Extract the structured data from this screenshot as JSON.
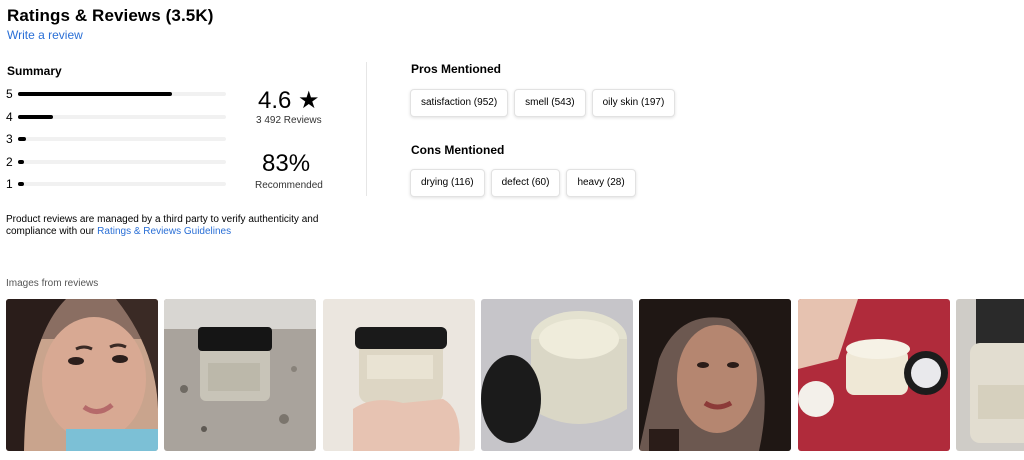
{
  "header": {
    "title": "Ratings & Reviews (3.5K)",
    "write_review": "Write a review"
  },
  "summary": {
    "label": "Summary",
    "distribution": [
      {
        "stars": "5",
        "fraction": 0.74
      },
      {
        "stars": "4",
        "fraction": 0.17
      },
      {
        "stars": "3",
        "fraction": 0.04
      },
      {
        "stars": "2",
        "fraction": 0.02
      },
      {
        "stars": "1",
        "fraction": 0.02
      }
    ],
    "average": "4.6 ★",
    "review_count": "3 492 Reviews",
    "recommended_pct": "83%",
    "recommended_label": "Recommended"
  },
  "pros": {
    "title": "Pros Mentioned",
    "items": [
      "satisfaction (952)",
      "smell (543)",
      "oily skin (197)"
    ]
  },
  "cons": {
    "title": "Cons Mentioned",
    "items": [
      "drying (116)",
      "defect (60)",
      "heavy (28)"
    ]
  },
  "disclaimer": {
    "text": "Product reviews are managed by a third party to verify authenticity and compliance with our ",
    "link": "Ratings & Reviews Guidelines"
  },
  "images": {
    "label": "Images from reviews",
    "thumbnails": [
      {
        "name": "review-photo-selfie-1",
        "bg": "#d9b8a2"
      },
      {
        "name": "review-photo-jar-countertop",
        "bg": "#b9b2a8"
      },
      {
        "name": "review-photo-jar-in-hand",
        "bg": "#ece8e2"
      },
      {
        "name": "review-photo-open-jar",
        "bg": "#c5c5c8"
      },
      {
        "name": "review-photo-selfie-2",
        "bg": "#a98a76"
      },
      {
        "name": "review-photo-jar-red-background",
        "bg": "#b8303f"
      },
      {
        "name": "review-photo-jar-closeup",
        "bg": "#d2d0cc"
      }
    ]
  }
}
